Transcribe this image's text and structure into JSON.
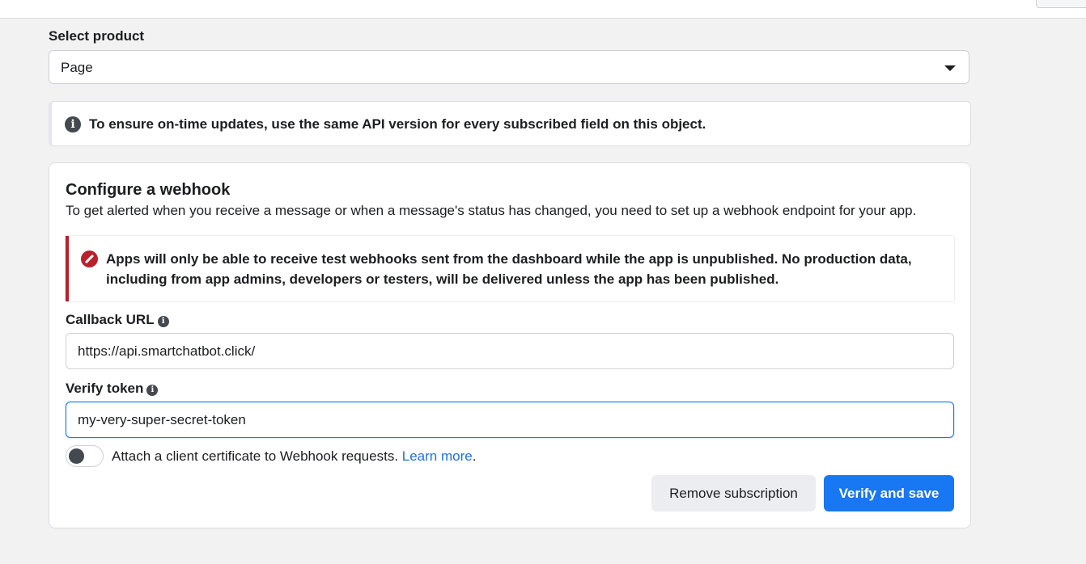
{
  "product": {
    "label": "Select product",
    "selected": "Page"
  },
  "notice": {
    "text": "To ensure on-time updates, use the same API version for every subscribed field on this object."
  },
  "webhook": {
    "title": "Configure a webhook",
    "description": "To get alerted when you receive a message or when a message's status has changed, you need to set up a webhook endpoint for your app.",
    "alert": "Apps will only be able to receive test webhooks sent from the dashboard while the app is unpublished. No production data, including from app admins, developers or testers, will be delivered unless the app has been published.",
    "callback_label": "Callback URL",
    "callback_value": "https://api.smartchatbot.click/",
    "verify_label": "Verify token",
    "verify_value": "my-very-super-secret-token",
    "cert_text": "Attach a client certificate to Webhook requests. ",
    "cert_link": "Learn more",
    "cert_tail": ".",
    "cert_enabled": false,
    "remove_label": "Remove subscription",
    "save_label": "Verify and save"
  },
  "colors": {
    "primary": "#1877f2",
    "error": "#b9202c",
    "link": "#216fdb"
  },
  "icons": {
    "info": "info-circle-icon",
    "error": "no-entry-icon",
    "dropdown": "caret-down-icon"
  }
}
